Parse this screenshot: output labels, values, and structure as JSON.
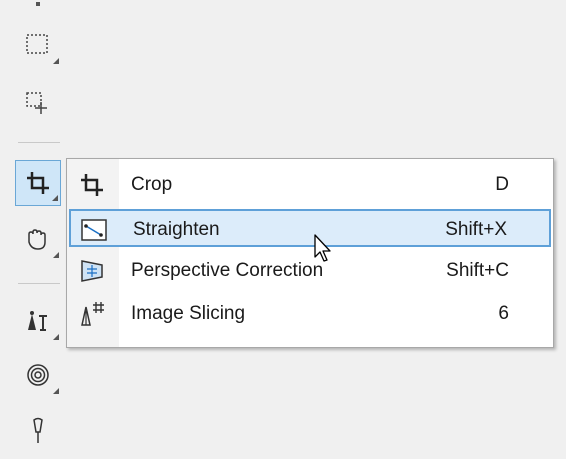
{
  "flyout": {
    "items": [
      {
        "label": "Crop",
        "shortcut": "D",
        "icon": "crop-icon",
        "highlighted": false
      },
      {
        "label": "Straighten",
        "shortcut": "Shift+X",
        "icon": "straighten-icon",
        "highlighted": true
      },
      {
        "label": "Perspective Correction",
        "shortcut": "Shift+C",
        "icon": "perspective-correction-icon",
        "highlighted": false
      },
      {
        "label": "Image Slicing",
        "shortcut": "6",
        "icon": "image-slicing-icon",
        "highlighted": false
      }
    ]
  },
  "toolbar": {
    "tools": [
      "rectangle-select-icon",
      "freehand-select-icon",
      "crop-icon",
      "pan-hand-icon",
      "fill-text-icon",
      "spiral-icon",
      "brush-icon"
    ],
    "active_tool": "crop-icon"
  },
  "colors": {
    "highlight_background": "#dcecfa",
    "highlight_border": "#5ea0d8",
    "active_tool_background": "#cfe6f8"
  }
}
